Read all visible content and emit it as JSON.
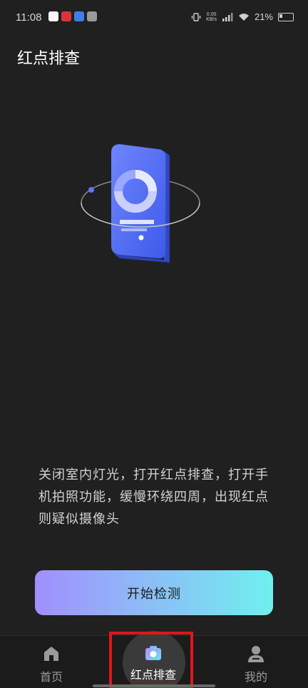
{
  "status_bar": {
    "time": "11:08",
    "app_icons": [
      "tiktok-icon",
      "app-icon-red",
      "app-icon-blue",
      "app-icon-gray"
    ],
    "net_speed_value": "0.00",
    "net_speed_unit": "KB/s",
    "battery": "21%"
  },
  "page": {
    "title": "红点排查"
  },
  "instruction": "关闭室内灯光，打开红点排查，打开手机拍照功能，缓慢环绕四周，出现红点则疑似摄像头",
  "start_button": {
    "label": "开始检测"
  },
  "bottom_nav": {
    "items": [
      {
        "label": "首页",
        "icon": "home-icon"
      },
      {
        "label": "红点排查",
        "icon": "camera-icon",
        "active": true
      },
      {
        "label": "我的",
        "icon": "user-icon"
      }
    ]
  },
  "colors": {
    "background": "#202020",
    "button_gradient_start": "#a08fff",
    "button_gradient_end": "#6ef0ee",
    "highlight": "#e0161c"
  }
}
